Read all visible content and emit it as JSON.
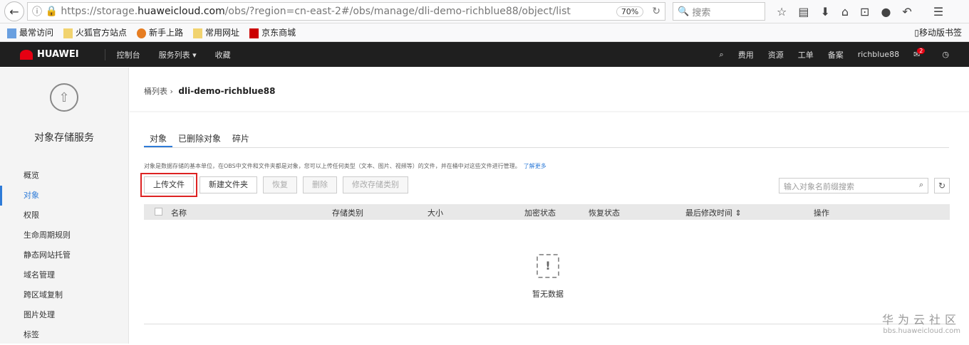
{
  "browser": {
    "url_prefix": "https://storage.",
    "url_host": "huaweicloud.com",
    "url_path": "/obs/?region=cn-east-2#/obs/manage/dli-demo-richblue88/object/list",
    "zoom": "70%",
    "search_placeholder": "搜索"
  },
  "bookmarks": [
    "最常访问",
    "火狐官方站点",
    "新手上路",
    "常用网址",
    "京东商城"
  ],
  "mobile_bookmarks": "移动版书签",
  "topbar": {
    "logo": "HUAWEI",
    "nav": [
      "控制台",
      "服务列表 ▾",
      "收藏"
    ],
    "right": [
      "费用",
      "资源",
      "工单",
      "备案",
      "richblue88"
    ],
    "badge": "2"
  },
  "sidebar": {
    "title": "对象存储服务",
    "items": [
      "概览",
      "对象",
      "权限",
      "生命周期规则",
      "静态网站托管",
      "域名管理",
      "跨区域复制",
      "图片处理",
      "标签"
    ]
  },
  "breadcrumb": {
    "parent": "桶列表",
    "current": "dli-demo-richblue88"
  },
  "tabs": [
    "对象",
    "已删除对象",
    "碎片"
  ],
  "description": "对象是数据存储的基本单位，在OBS中文件和文件夹都是对象，您可以上传任何类型（文本、图片、视频等）的文件，并在桶中对这些文件进行管理。",
  "learn_more": "了解更多",
  "buttons": [
    "上传文件",
    "新建文件夹",
    "恢复",
    "删除",
    "修改存储类别"
  ],
  "search_placeholder": "输入对象名前缀搜索",
  "columns": [
    "名称",
    "存储类别",
    "大小",
    "加密状态",
    "恢复状态",
    "最后修改时间 ⇕",
    "操作"
  ],
  "empty": "暂无数据",
  "watermark": {
    "title": "华为云社区",
    "url": "bbs.huaweicloud.com"
  }
}
